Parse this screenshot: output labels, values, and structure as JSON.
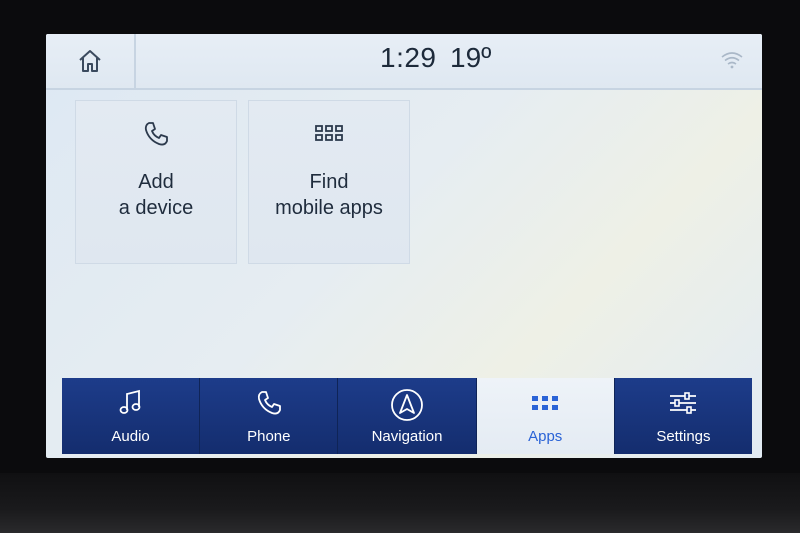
{
  "status": {
    "time": "1:29",
    "temperature": "19º",
    "home_icon": "home-icon",
    "wifi_icon": "wifi-icon"
  },
  "tiles": [
    {
      "icon": "phone-icon",
      "line1": "Add",
      "line2": "a device"
    },
    {
      "icon": "grid-icon",
      "line1": "Find",
      "line2": "mobile apps"
    }
  ],
  "nav": [
    {
      "label": "Audio",
      "icon": "music-note-icon",
      "active": false
    },
    {
      "label": "Phone",
      "icon": "phone-icon",
      "active": false
    },
    {
      "label": "Navigation",
      "icon": "navigation-icon",
      "active": false
    },
    {
      "label": "Apps",
      "icon": "grid-icon",
      "active": true
    },
    {
      "label": "Settings",
      "icon": "sliders-icon",
      "active": false
    }
  ],
  "colors": {
    "nav_bg": "#1d3c8a",
    "active_accent": "#2a63d6",
    "text_dark": "#1d2a3a"
  }
}
